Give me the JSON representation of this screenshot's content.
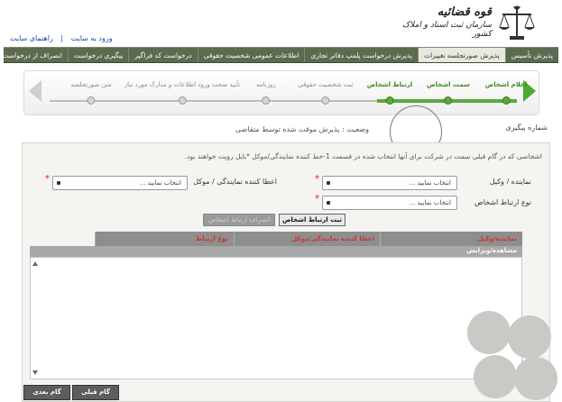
{
  "header": {
    "logo_line1": "قوه قضائیه",
    "logo_line2": "سازمان ثبت اسناد و املاک کشور",
    "links": [
      "ورود به سایت",
      "راهنمای سایت"
    ]
  },
  "navbar": {
    "items": [
      {
        "label": "پذیرش تأسیس",
        "active": false
      },
      {
        "label": "پذیرش صورتجلسه تغییرات",
        "active": true
      },
      {
        "label": "پذیرش درخواست پلمپ دفاتر تجاری",
        "active": false
      },
      {
        "label": "اطلاعات عمومی شخصیت حقوقی",
        "active": false
      },
      {
        "label": "درخواست کد فراگیر",
        "active": false
      },
      {
        "label": "پیگیری درخواست",
        "active": false
      },
      {
        "label": "انصراف از درخواست",
        "active": false
      }
    ]
  },
  "wizard": {
    "steps": [
      {
        "label": "اعلام اشخاص",
        "done": true
      },
      {
        "label": "سمت اشخاص",
        "done": true
      },
      {
        "label": "ارتباط اشخاص",
        "done": true
      },
      {
        "label": "ثبت شخصیت حقوقی",
        "done": false
      },
      {
        "label": "روزنامه",
        "done": false
      },
      {
        "label": "تأیید صحت ورود اطلاعات و مدارک مورد نیاز",
        "done": false
      },
      {
        "label": "متن صورتجلسه",
        "done": false
      }
    ]
  },
  "tracking": {
    "label": "شماره پیگیری",
    "status": "وضعیت : پذیرش موقت شده توسط متقاضی"
  },
  "form": {
    "info": "اشخاصی که در گام قبلی سمت در شرکت برای آنها انتخاب شده در قسمت 1-خط کننده نمایندگی/موکل *بایل رویت خواهند بود.",
    "rep_label": "نماینده / وکیل",
    "rep_placeholder": "انتخاب نمایید ...",
    "granter_label": "اعطا کننده نمایندگی / موکل",
    "granter_placeholder": "انتخاب نمایید ...",
    "relation_label": "نوع ارتباط اشخاص",
    "relation_placeholder": "انتخاب نمایید ...",
    "btn_set": "ثبت ارتباط اشخاص",
    "btn_clear": "انصراف ارتباط اشخاص"
  },
  "table": {
    "headers": [
      "نماینده/وکیل",
      "اعطا کننده نمایندگی/موکل",
      "نوع ارتباط"
    ],
    "subheader": "مشاهده/ویرایش"
  },
  "bottom": {
    "prev": "گام قبلی",
    "next": "گام بعدی"
  }
}
